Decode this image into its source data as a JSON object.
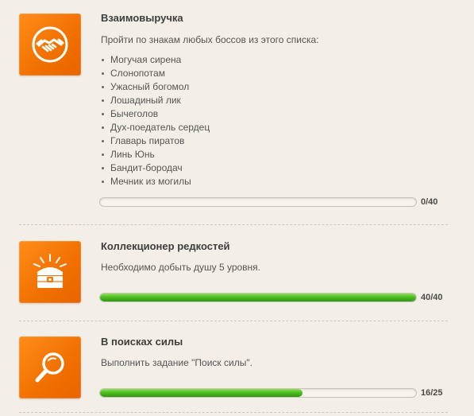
{
  "achievements": [
    {
      "icon": "handshake-icon",
      "title": "Взаимовыручка",
      "description": "Пройти по знакам любых боссов из этого списка:",
      "bosses": [
        "Могучая сирена",
        "Слонопотам",
        "Ужасный богомол",
        "Лошадиный лик",
        "Бычеголов",
        "Дух-поедатель сердец",
        "Главарь пиратов",
        "Линь Юнь",
        "Бандит-бородач",
        "Мечник из могилы"
      ],
      "progress": {
        "current": 0,
        "total": 40,
        "text": "0/40"
      }
    },
    {
      "icon": "treasure-chest-icon",
      "title": "Коллекционер редкостей",
      "description": "Необходимо добыть душу 5 уровня.",
      "progress": {
        "current": 40,
        "total": 40,
        "text": "40/40"
      }
    },
    {
      "icon": "magnifier-icon",
      "title": "В поисках силы",
      "description": "Выполнить задание \"Поиск силы\".",
      "progress": {
        "current": 16,
        "total": 25,
        "text": "16/25"
      }
    }
  ],
  "colors": {
    "icon_background": "#f07a0a",
    "progress_fill": "#4fbb22",
    "page_background": "#f3efe8"
  }
}
